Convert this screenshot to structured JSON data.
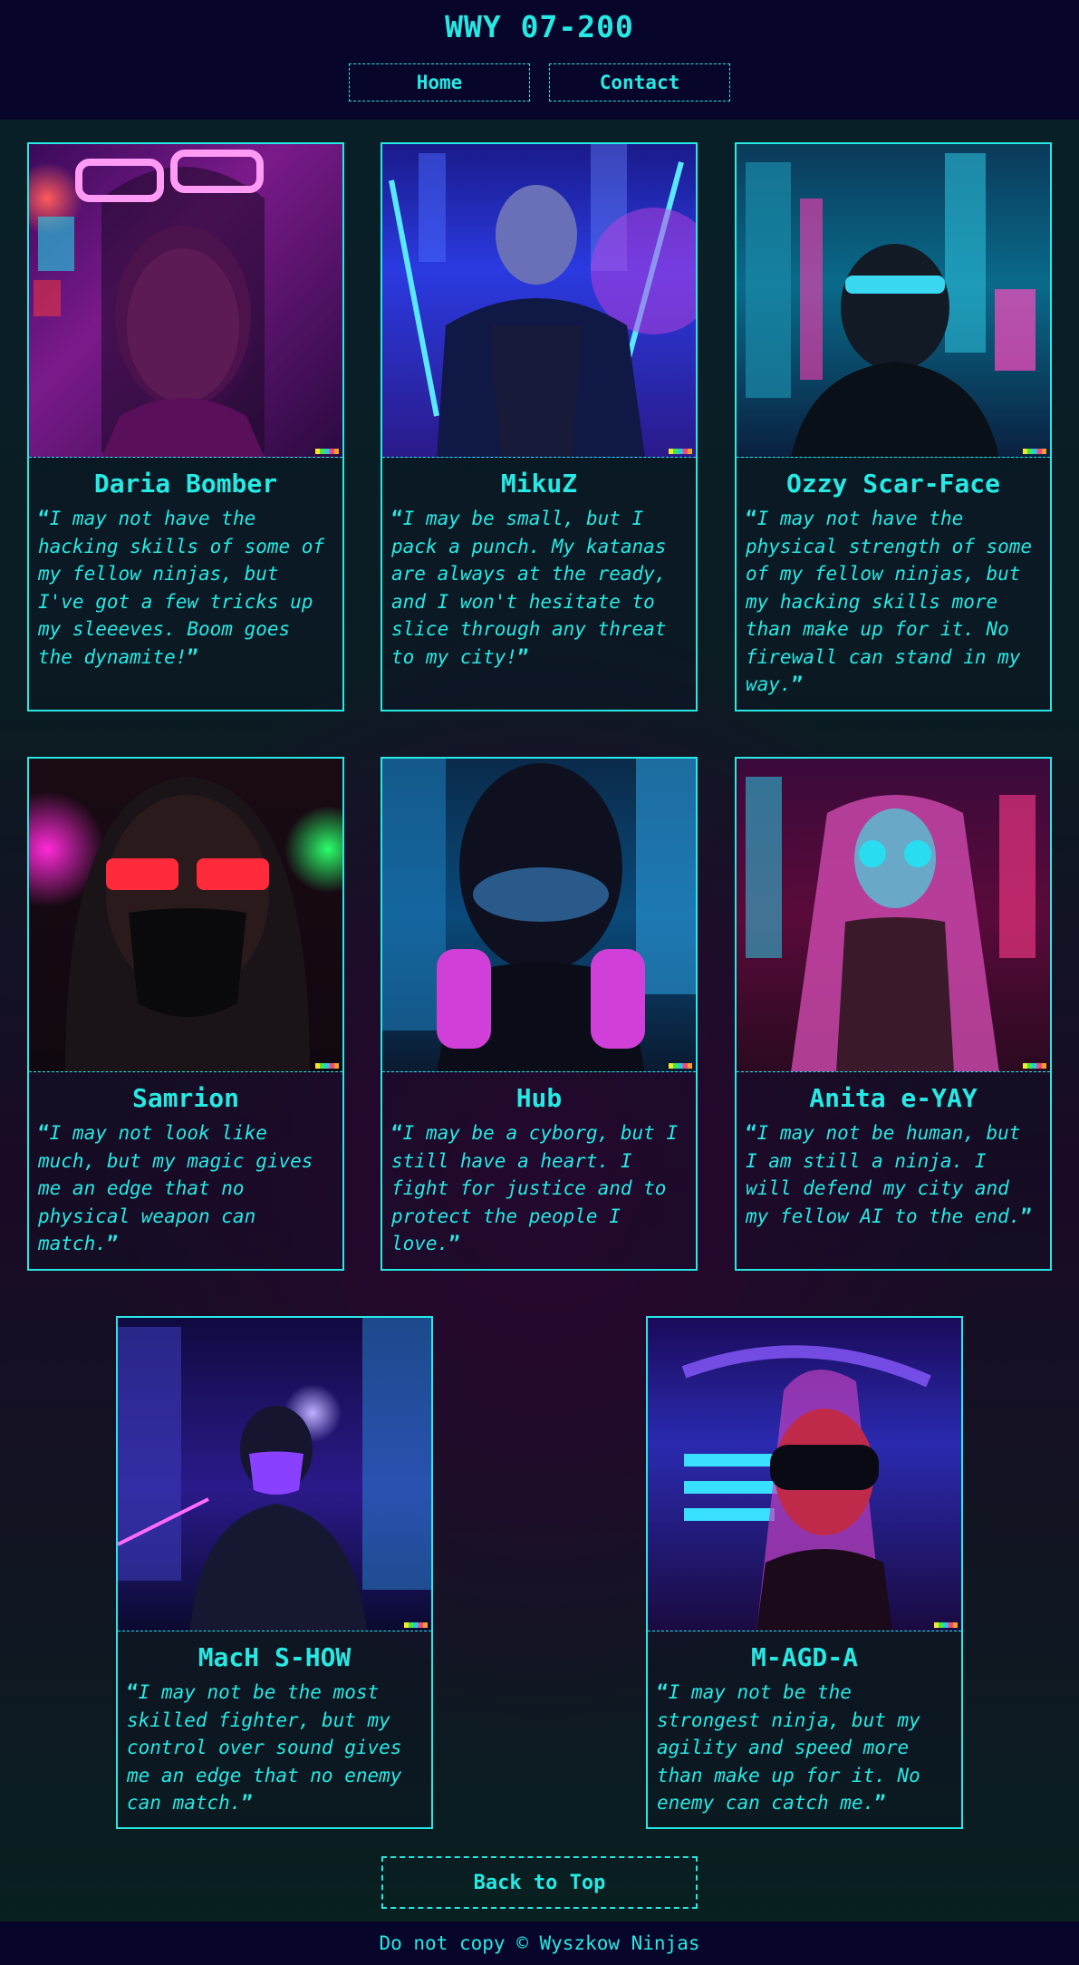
{
  "site": {
    "title": "WWY 07-200"
  },
  "nav": {
    "home": "Home",
    "contact": "Contact"
  },
  "cards": [
    {
      "name": "Daria Bomber",
      "quote": "I may not have the hacking skills of some of my fellow ninjas, but I've got a few tricks up my sleeeves. Boom goes the dynamite!"
    },
    {
      "name": "MikuZ",
      "quote": "I may be small, but I pack a punch. My katanas are always at the ready, and I won't hesitate to slice through any threat to my city!"
    },
    {
      "name": "Ozzy Scar-Face",
      "quote": "I may not have the physical strength of some of my fellow ninjas, but my hacking skills more than make up for it. No firewall can stand in my way."
    },
    {
      "name": "Samrion",
      "quote": "I may not look like much, but my magic gives me an edge that no physical weapon can match."
    },
    {
      "name": "Hub",
      "quote": "I may be a cyborg, but I still have a heart. I fight for justice and to protect the people I love."
    },
    {
      "name": "Anita e-YAY",
      "quote": "I may not be human, but I am still a ninja. I will defend my city and my fellow AI to the end."
    },
    {
      "name": "MacH S-HOW",
      "quote": "I may not be the most skilled fighter, but my control over sound gives me an edge that no enemy can match."
    },
    {
      "name": "M-AGD-A",
      "quote": "I may not be the strongest ninja, but my agility and speed more than make up for it. No enemy can catch me."
    }
  ],
  "quote_marks": {
    "open": "“",
    "close": "”"
  },
  "back_to_top": "Back to Top",
  "footer": {
    "text": "Do not copy © Wyszkow Ninjas"
  },
  "colors": {
    "accent": "#27e9e4",
    "header_bg": "#07062a"
  }
}
